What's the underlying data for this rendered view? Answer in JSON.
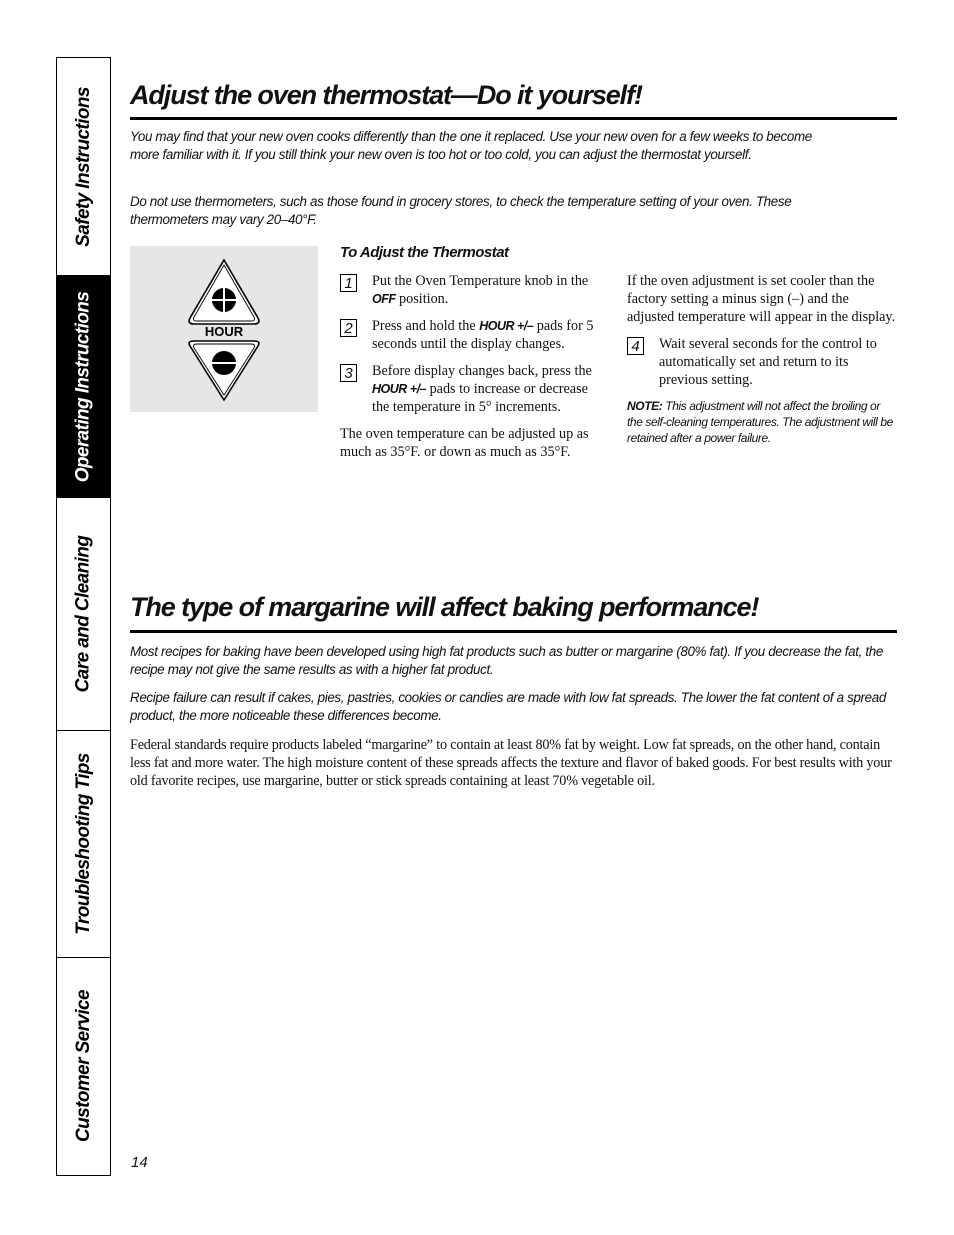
{
  "sidebar": {
    "tabs": [
      {
        "label": "Safety Instructions",
        "active": false
      },
      {
        "label": "Operating Instructions",
        "active": true
      },
      {
        "label": "Care and Cleaning",
        "active": false
      },
      {
        "label": "Troubleshooting Tips",
        "active": false
      },
      {
        "label": "Customer Service",
        "active": false
      }
    ]
  },
  "section1": {
    "title": "Adjust the oven thermostat—Do it yourself!",
    "intro": [
      "You may find that your new oven cooks differently than the one it replaced. Use your new oven for a few weeks to become more familiar with it. If you still think your new oven is too hot or too cold, you can adjust the thermostat yourself.",
      "Do not use thermometers, such as those found in grocery stores, to check the temperature setting of your oven. These thermometers may vary 20–40°F."
    ],
    "figure": {
      "label": "HOUR",
      "up_icon": "plus-triangle-up",
      "down_icon": "minus-triangle-down"
    },
    "subheading": "To Adjust the Thermostat",
    "steps": [
      {
        "num": "1",
        "pre": "Put the Oven Temperature knob in the ",
        "kw": "OFF",
        "post": " position."
      },
      {
        "num": "2",
        "pre": "Press and hold the ",
        "kw": "HOUR +/–",
        "post": " pads for 5 seconds until the display changes."
      },
      {
        "num": "3",
        "pre": "Before display changes back, press the ",
        "kw": "HOUR +/–",
        "post": " pads to increase or decrease the temperature in 5° increments."
      },
      {
        "num": "4",
        "pre": "Wait several seconds for the control to automatically set and return to its previous setting.",
        "kw": "",
        "post": ""
      }
    ],
    "range_text": "The oven temperature can be adjusted up as much as 35°F. or down as much as 35°F.",
    "cooler_text": "If the oven adjustment is set cooler than the factory setting a minus sign (–) and the adjusted temperature will appear in the display.",
    "note_label": "NOTE:",
    "note_text": " This adjustment will not affect the broiling or the self-cleaning temperatures. The adjustment will be retained after a power failure."
  },
  "section2": {
    "title": "The type of margarine will affect baking performance!",
    "intro": [
      "Most recipes for baking have been developed using high fat products such as butter or margarine (80% fat). If you decrease the fat, the recipe may not give the same results as with a higher fat product.",
      "Recipe failure can result if cakes, pies, pastries, cookies or candies are made with low fat spreads. The lower the fat content of a spread product, the more noticeable these differences become."
    ],
    "body": "Federal standards require products labeled “margarine” to contain at least 80% fat by weight. Low fat spreads, on the other hand, contain less fat and more water. The high moisture content of these spreads affects the texture and flavor of baked goods. For best results with your old favorite recipes, use margarine, butter or stick spreads containing at least 70% vegetable oil."
  },
  "page_number": "14"
}
